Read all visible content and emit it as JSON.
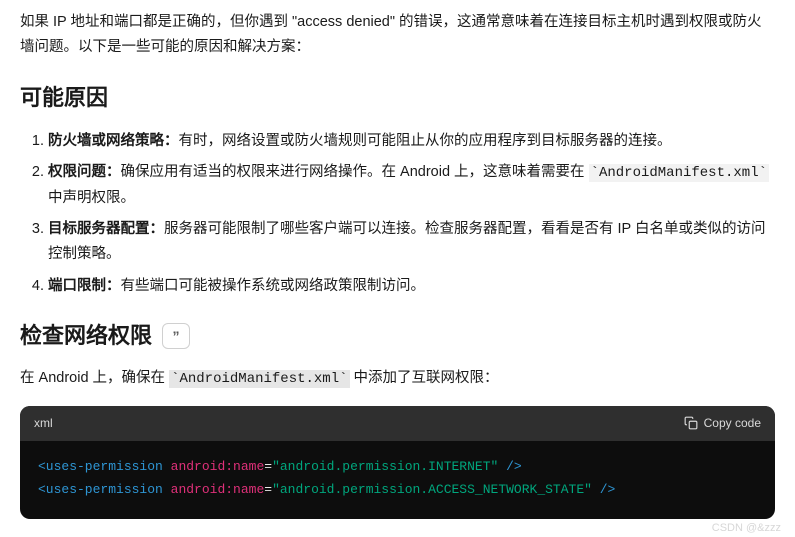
{
  "intro": "如果 IP 地址和端口都是正确的，但你遇到 \"access denied\" 的错误，这通常意味着在连接目标主机时遇到权限或防火墙问题。以下是一些可能的原因和解决方案：",
  "sections": {
    "causes": {
      "heading": "可能原因",
      "items": [
        {
          "title": "防火墙或网络策略：",
          "text_a": "有时，网络设置或防火墙规则可能阻止从你的应用程序到目标服务器的连接。"
        },
        {
          "title": "权限问题：",
          "text_a": "确保应用有适当的权限来进行网络操作。在 Android 上，这意味着需要在 ",
          "code": "`AndroidManifest.xml`",
          "text_b": " 中声明权限。"
        },
        {
          "title": "目标服务器配置：",
          "text_a": "服务器可能限制了哪些客户端可以连接。检查服务器配置，看看是否有 IP 白名单或类似的访问控制策略。"
        },
        {
          "title": "端口限制：",
          "text_a": "有些端口可能被操作系统或网络政策限制访问。"
        }
      ]
    },
    "check": {
      "heading": "检查网络权限",
      "quote_glyph": "”",
      "para_a": "在 Android 上，确保在 ",
      "para_code": "`AndroidManifest.xml`",
      "para_b": " 中添加了互联网权限："
    }
  },
  "codeblock": {
    "lang": "xml",
    "copy_label": "Copy code",
    "lines": [
      {
        "tag_open": "<uses-permission",
        "sp": " ",
        "attr": "android:name",
        "eq": "=",
        "str": "\"android.permission.INTERNET\"",
        "tag_close": " />"
      },
      {
        "tag_open": "<uses-permission",
        "sp": " ",
        "attr": "android:name",
        "eq": "=",
        "str": "\"android.permission.ACCESS_NETWORK_STATE\"",
        "tag_close": " />"
      }
    ]
  },
  "watermark": "CSDN @&zzz"
}
